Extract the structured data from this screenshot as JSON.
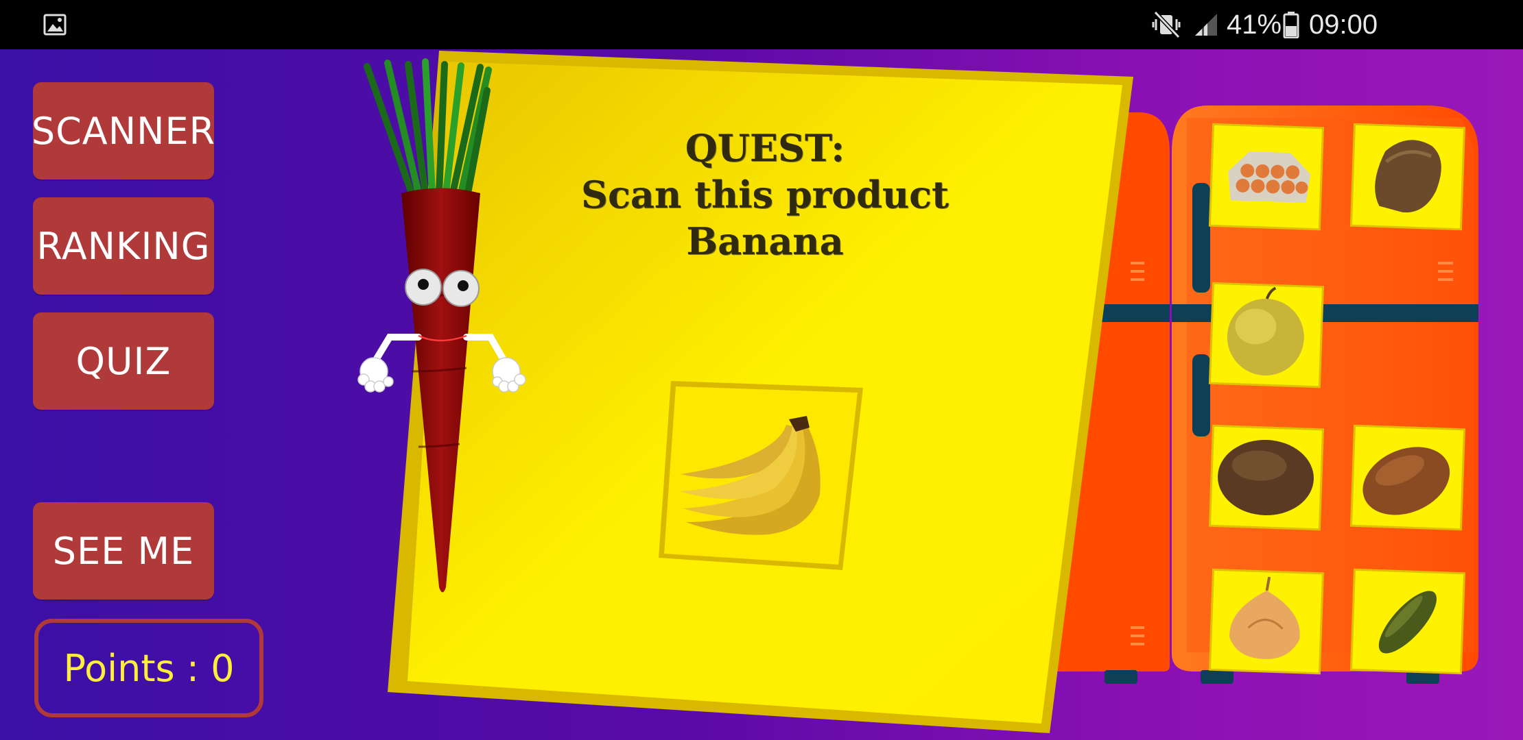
{
  "status_bar": {
    "battery": "41%",
    "time": "09:00",
    "icons": [
      "gallery-icon",
      "mute-vibrate-icon",
      "signal-icon",
      "battery-icon"
    ]
  },
  "menu": {
    "scanner": "SCANNER",
    "ranking": "RANKING",
    "quiz": "QUIZ",
    "see_me": "SEE ME"
  },
  "points": {
    "label": "Points : 0"
  },
  "quest": {
    "title": "QUEST:",
    "instruction": "Scan this product",
    "product": "Banana",
    "product_icon": "banana-icon"
  },
  "fridge": {
    "items": [
      "eggs-icon",
      "bread-loaf-icon",
      "apple-icon",
      "seeded-roll-icon",
      "bread-roll-icon",
      "onion-icon",
      "pickle-icon"
    ]
  },
  "colors": {
    "menu_button": "#b03a3a",
    "points_text": "#ffef3a",
    "card": "#ffe600",
    "fridge": "#ff5a10"
  }
}
